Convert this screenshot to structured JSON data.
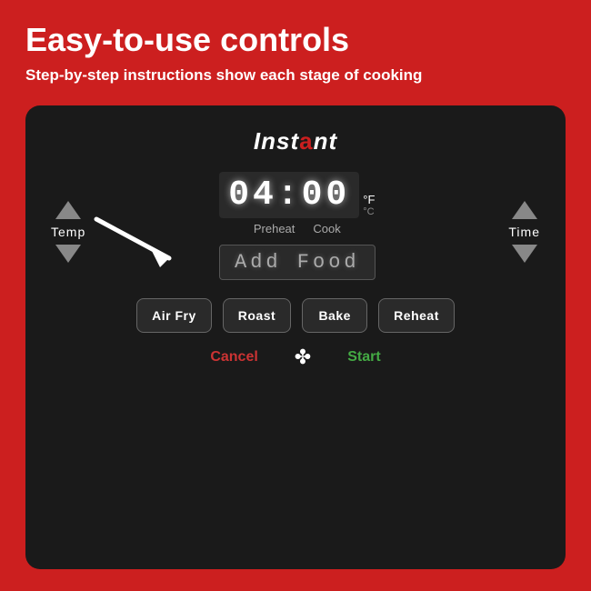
{
  "page": {
    "background": "#cc1f1f"
  },
  "header": {
    "main_title": "Easy-to-use controls",
    "subtitle": "Step-by-step instructions show each stage of cooking"
  },
  "device": {
    "brand": "Instant",
    "brand_dot": "a",
    "display": {
      "time": "04:00",
      "unit_f": "°F",
      "unit_c": "°C",
      "stage_preheat": "Preheat",
      "stage_cook": "Cook",
      "add_food": "Add Food"
    },
    "controls": {
      "temp_label": "Temp",
      "time_label": "Time"
    },
    "buttons": [
      {
        "id": "air-fry",
        "label": "Air Fry"
      },
      {
        "id": "roast",
        "label": "Roast"
      },
      {
        "id": "bake",
        "label": "Bake"
      },
      {
        "id": "reheat",
        "label": "Reheat"
      }
    ],
    "bottom": {
      "cancel": "Cancel",
      "start": "Start"
    }
  }
}
